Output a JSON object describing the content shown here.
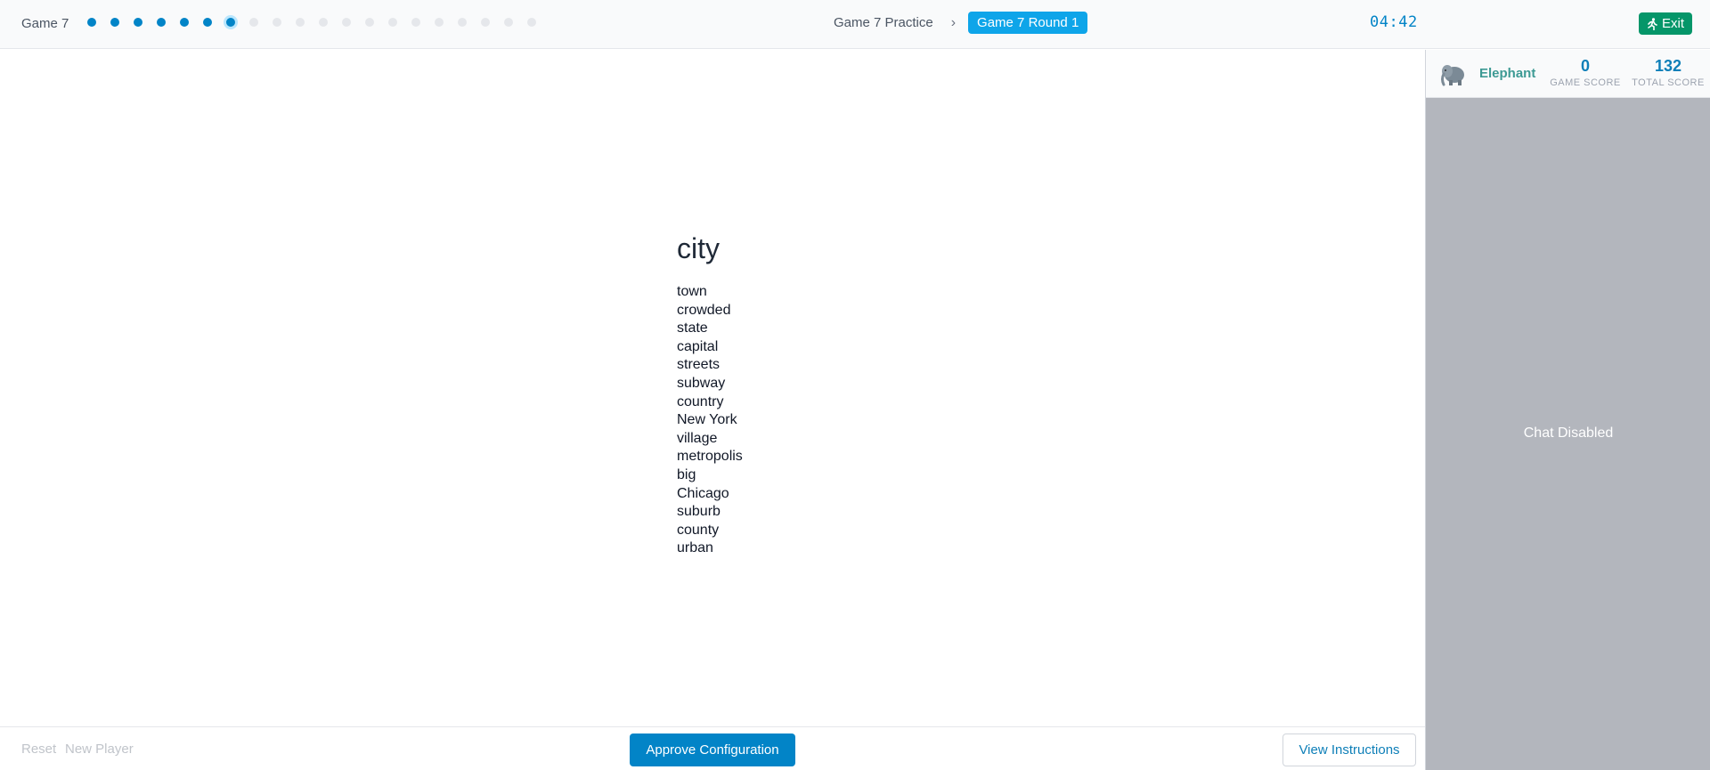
{
  "header": {
    "game_label": "Game 7",
    "progress": {
      "total": 20,
      "completed": 6,
      "current_index": 6
    },
    "breadcrumb_parent": "Game 7 Practice",
    "breadcrumb_current": "Game 7 Round 1",
    "timer": "04:42",
    "exit_label": "Exit"
  },
  "main": {
    "target_word": "city",
    "associations": [
      "town",
      "crowded",
      "state",
      "capital",
      "streets",
      "subway",
      "country",
      "New York",
      "village",
      "metropolis",
      "big",
      "Chicago",
      "suburb",
      "county",
      "urban"
    ]
  },
  "sidebar": {
    "player_name": "Elephant",
    "avatar_icon": "elephant-icon",
    "game_score": "0",
    "game_score_label": "GAME SCORE",
    "total_score": "132",
    "total_score_label": "TOTAL SCORE",
    "chat_status": "Chat Disabled"
  },
  "footer": {
    "reset_label": "Reset",
    "new_player_label": "New Player",
    "approve_label": "Approve Configuration",
    "instructions_label": "View Instructions"
  },
  "colors": {
    "accent": "#0284c7",
    "exit": "#059669",
    "player_name": "#3d9a94",
    "sidebar_bg": "#b3b6bd"
  }
}
